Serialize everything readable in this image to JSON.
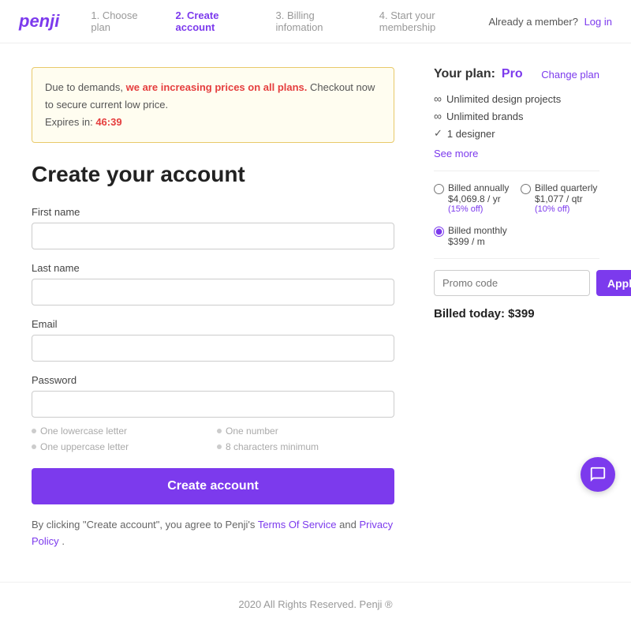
{
  "header": {
    "logo": "penji",
    "steps": [
      {
        "num": "1.",
        "label": "Choose plan",
        "state": "inactive"
      },
      {
        "num": "2.",
        "label": "Create account",
        "state": "active"
      },
      {
        "num": "3.",
        "label": "Billing infomation",
        "state": "inactive"
      },
      {
        "num": "4.",
        "label": "Start your membership",
        "state": "inactive"
      }
    ],
    "already_member_text": "Already a member?",
    "log_in_label": "Log in"
  },
  "notice": {
    "prefix": "Due to demands, ",
    "highlight": "we are increasing prices on all plans.",
    "suffix": " Checkout now to secure current low price.",
    "expires_label": "Expires in:",
    "timer": "46:39"
  },
  "form": {
    "title": "Create your account",
    "first_name_label": "First name",
    "first_name_placeholder": "",
    "last_name_label": "Last name",
    "last_name_placeholder": "",
    "email_label": "Email",
    "email_placeholder": "",
    "password_label": "Password",
    "password_placeholder": "",
    "hints": [
      {
        "text": "One lowercase letter"
      },
      {
        "text": "One number"
      },
      {
        "text": "One uppercase letter"
      },
      {
        "text": "8 characters minimum"
      }
    ],
    "create_btn_label": "Create account",
    "terms_prefix": "By clicking \"Create account\", you agree to Penji's",
    "terms_of_service": "Terms Of Service",
    "terms_and": "and",
    "privacy_policy": "Privacy Policy",
    "terms_suffix": "."
  },
  "plan": {
    "label": "Your plan:",
    "name": "Pro",
    "change_label": "Change plan",
    "features": [
      {
        "icon": "∞",
        "text": "Unlimited design projects"
      },
      {
        "icon": "∞",
        "text": "Unlimited brands"
      },
      {
        "icon": "✓",
        "text": "1 designer"
      }
    ],
    "see_more": "See more",
    "billing_options": [
      {
        "id": "annually",
        "label": "Billed annually",
        "amount": "$4,069.8 / yr",
        "discount": "(15% off)",
        "checked": false
      },
      {
        "id": "quarterly",
        "label": "Billed quarterly",
        "amount": "$1,077 / qtr",
        "discount": "(10% off)",
        "checked": false
      },
      {
        "id": "monthly",
        "label": "Billed monthly",
        "amount": "$399 / m",
        "discount": "",
        "checked": true
      }
    ],
    "promo_placeholder": "Promo code",
    "apply_label": "Apply",
    "billed_today": "Billed today: $399"
  },
  "footer": {
    "text": "2020 All Rights Reserved. Penji ®"
  }
}
